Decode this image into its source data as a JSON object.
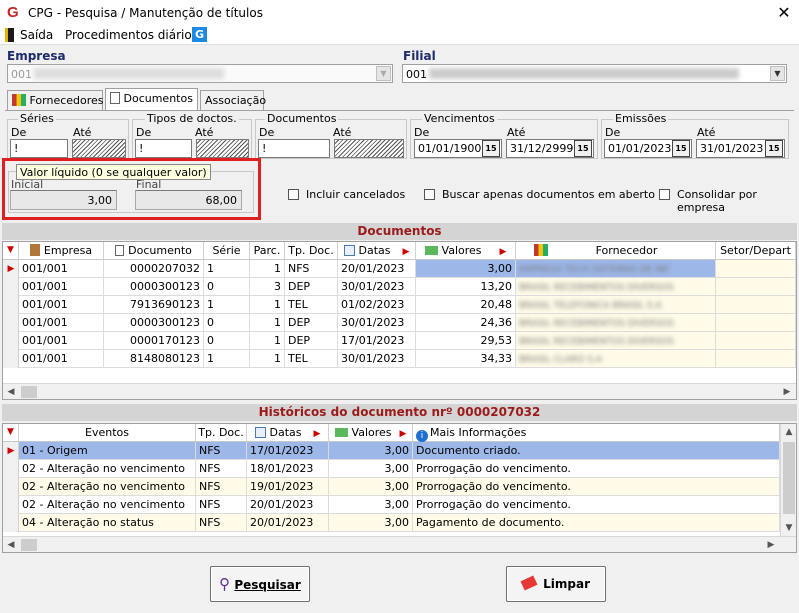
{
  "window": {
    "title": "CPG - Pesquisa / Manutenção de títulos",
    "close": "✕"
  },
  "menu": {
    "exit": "Saída",
    "daily": "Procedimentos diários"
  },
  "empresa": {
    "label": "Empresa",
    "value": "001"
  },
  "filial": {
    "label": "Filial",
    "value": "001"
  },
  "tabs": [
    "Fornecedores",
    "Documentos",
    "Associação"
  ],
  "filters": {
    "series": {
      "label": "Séries",
      "de": "De",
      "ate": "Até",
      "from": "!"
    },
    "tipos": {
      "label": "Tipos de doctos.",
      "de": "De",
      "ate": "Até",
      "from": "!"
    },
    "documentos": {
      "label": "Documentos",
      "de": "De",
      "ate": "Até",
      "from": "!"
    },
    "vencimentos": {
      "label": "Vencimentos",
      "de": "De",
      "ate": "Até",
      "from": "01/01/1900",
      "to": "31/12/2999"
    },
    "emissoes": {
      "label": "Emissões",
      "de": "De",
      "ate": "Até",
      "from": "01/01/2023",
      "to": "31/01/2023"
    },
    "cal": "15"
  },
  "valor": {
    "tooltip": "Valor líquido (0 se qualquer valor)",
    "inicial_label": "Inicial",
    "final_label": "Final",
    "inicial": "3,00",
    "final": "68,00"
  },
  "checks": {
    "cancelados": "Incluir cancelados",
    "abertos": "Buscar apenas documentos em aberto",
    "consolidar": "Consolidar por empresa"
  },
  "docs": {
    "title": "Documentos",
    "columns": [
      "Empresa",
      "Documento",
      "Série",
      "Parc.",
      "Tp. Doc.",
      "Datas",
      "Valores",
      "Fornecedor",
      "Setor/Depart"
    ],
    "rows": [
      {
        "empresa": "001/001",
        "documento": "0000207032",
        "serie": "1",
        "parc": "1",
        "tp": "NFS",
        "data": "20/01/2023",
        "valor": "3,00",
        "forn": "EMPRESA TECH SISTEMAS DE INF"
      },
      {
        "empresa": "001/001",
        "documento": "0000300123",
        "serie": "0",
        "parc": "3",
        "tp": "DEP",
        "data": "30/01/2023",
        "valor": "13,20",
        "forn": "BRASIL RECEBIMENTOS DIVERSOS"
      },
      {
        "empresa": "001/001",
        "documento": "7913690123",
        "serie": "1",
        "parc": "1",
        "tp": "TEL",
        "data": "01/02/2023",
        "valor": "20,48",
        "forn": "BRASIL TELEFONICA BRASIL S.A"
      },
      {
        "empresa": "001/001",
        "documento": "0000300123",
        "serie": "0",
        "parc": "1",
        "tp": "DEP",
        "data": "30/01/2023",
        "valor": "24,36",
        "forn": "BRASIL RECEBIMENTOS DIVERSOS"
      },
      {
        "empresa": "001/001",
        "documento": "0000170123",
        "serie": "0",
        "parc": "1",
        "tp": "DEP",
        "data": "17/01/2023",
        "valor": "29,53",
        "forn": "BRASIL RECEBIMENTOS DIVERSOS"
      },
      {
        "empresa": "001/001",
        "documento": "8148080123",
        "serie": "1",
        "parc": "1",
        "tp": "TEL",
        "data": "30/01/2023",
        "valor": "34,33",
        "forn": "BRASIL CLARO S.A"
      }
    ]
  },
  "hist": {
    "title": "Históricos do documento nrº 0000207032",
    "columns": [
      "Eventos",
      "Tp. Doc.",
      "Datas",
      "Valores",
      "Mais Informações"
    ],
    "rows": [
      {
        "evento": "01 - Origem",
        "tp": "NFS",
        "data": "17/01/2023",
        "valor": "3,00",
        "info": "Documento criado."
      },
      {
        "evento": "02 - Alteração no vencimento",
        "tp": "NFS",
        "data": "18/01/2023",
        "valor": "3,00",
        "info": "Prorrogação do vencimento."
      },
      {
        "evento": "02 - Alteração no vencimento",
        "tp": "NFS",
        "data": "19/01/2023",
        "valor": "3,00",
        "info": "Prorrogação do vencimento."
      },
      {
        "evento": "02 - Alteração no vencimento",
        "tp": "NFS",
        "data": "20/01/2023",
        "valor": "3,00",
        "info": "Prorrogação do vencimento."
      },
      {
        "evento": "04 - Alteração no status",
        "tp": "NFS",
        "data": "20/01/2023",
        "valor": "3,00",
        "info": "Pagamento de documento."
      }
    ]
  },
  "buttons": {
    "search": "Pesquisar",
    "clear": "Limpar"
  },
  "colors": {
    "selected_row": "#9cb7e8",
    "section_title": "#9b1b1b",
    "header_label": "#1c2a6e",
    "highlight_box": "#e02020"
  }
}
